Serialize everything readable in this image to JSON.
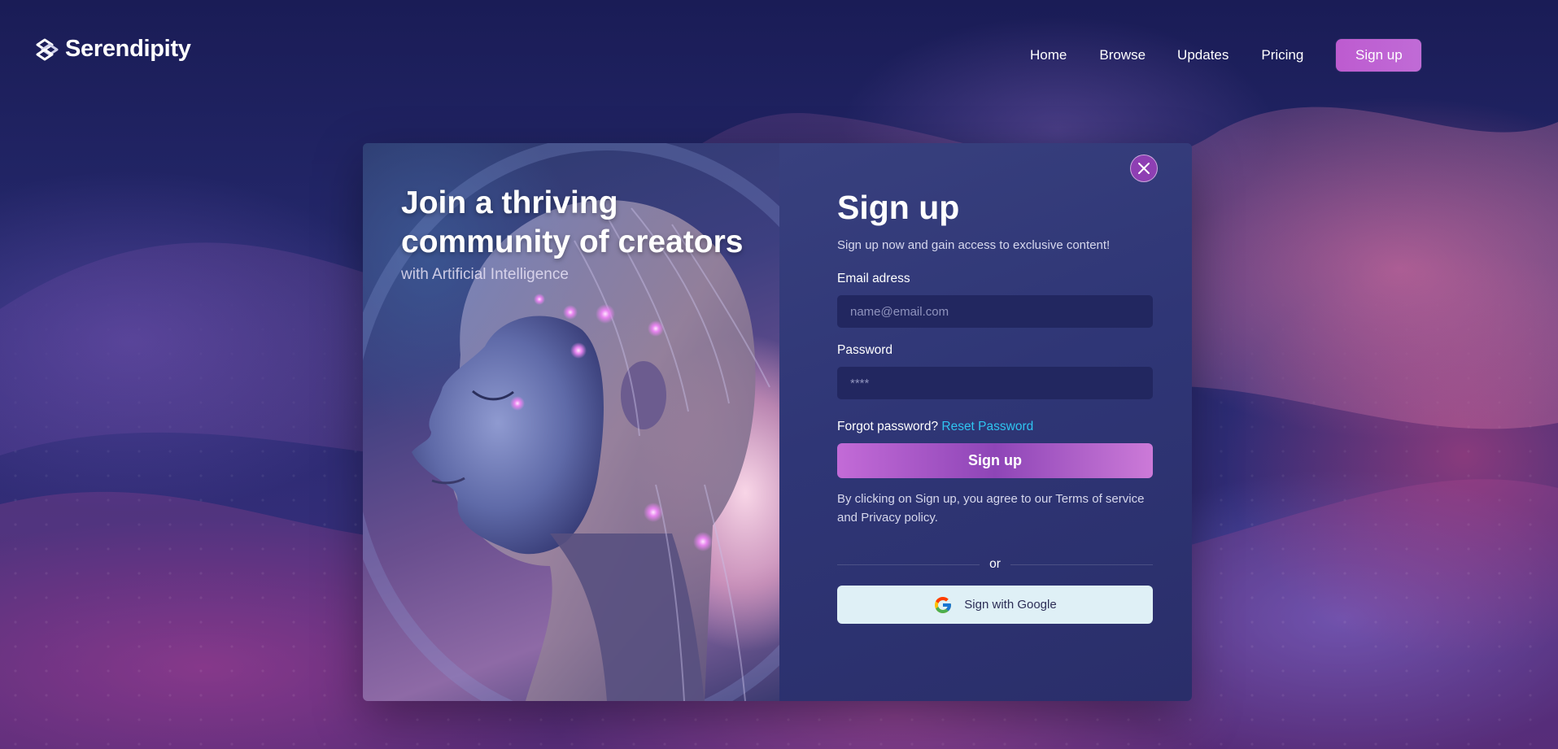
{
  "brand": {
    "name": "Serendipity",
    "logo_icon": "serendipity-logo-icon"
  },
  "nav": {
    "items": [
      {
        "label": "Home"
      },
      {
        "label": "Browse"
      },
      {
        "label": "Updates"
      },
      {
        "label": "Pricing"
      }
    ],
    "signup_label": "Sign up"
  },
  "hero": {
    "title_line1": "Join a thriving",
    "title_line2": "community of creators",
    "subtitle": "with Artificial Intelligence",
    "image": "ai-woman-portrait"
  },
  "modal": {
    "close_icon": "close-icon",
    "title": "Sign up",
    "subtitle": "Sign up now and gain access to exclusive content!",
    "email": {
      "label": "Email adress",
      "placeholder": "name@email.com",
      "value": ""
    },
    "password": {
      "label": "Password",
      "placeholder": "****",
      "value": ""
    },
    "forgot_text": "Forgot password?",
    "reset_link": "Reset Password",
    "submit_label": "Sign up",
    "terms_text": "By clicking on Sign up, you agree to our Terms of service and Privacy policy.",
    "divider_text": "or",
    "google_label": "Sign with Google",
    "google_icon": "google-icon"
  },
  "colors": {
    "accent": "#bd5bd0",
    "link": "#2fc4f0",
    "panel": "#2f3676",
    "input_bg": "#222760",
    "google_button_bg": "#dff0f6"
  }
}
